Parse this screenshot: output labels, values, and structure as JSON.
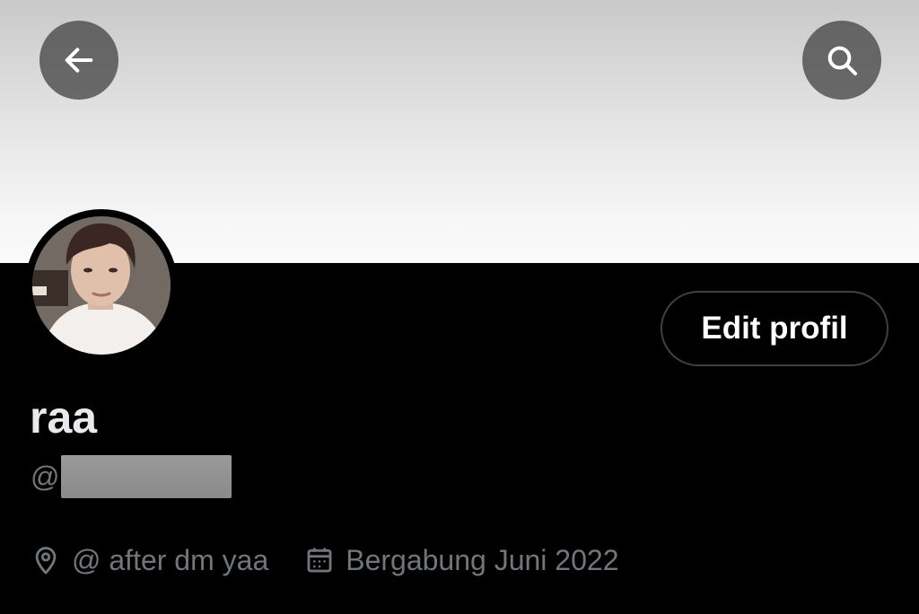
{
  "header": {
    "back_icon": "arrow-left-icon",
    "search_icon": "search-icon",
    "banner_colors": [
      "#c9c9c9",
      "#fafafa"
    ]
  },
  "profile": {
    "display_name": "raa",
    "handle_prefix": "@",
    "edit_button_label": "Edit profil",
    "location": "@ after dm yaa",
    "location_icon": "location-pin-icon",
    "joined": "Bergabung Juni 2022",
    "joined_icon": "calendar-icon"
  },
  "colors": {
    "background": "#000000",
    "primary_text": "#e7e9ea",
    "secondary_text": "#71767b",
    "button_border": "#3e4144"
  }
}
